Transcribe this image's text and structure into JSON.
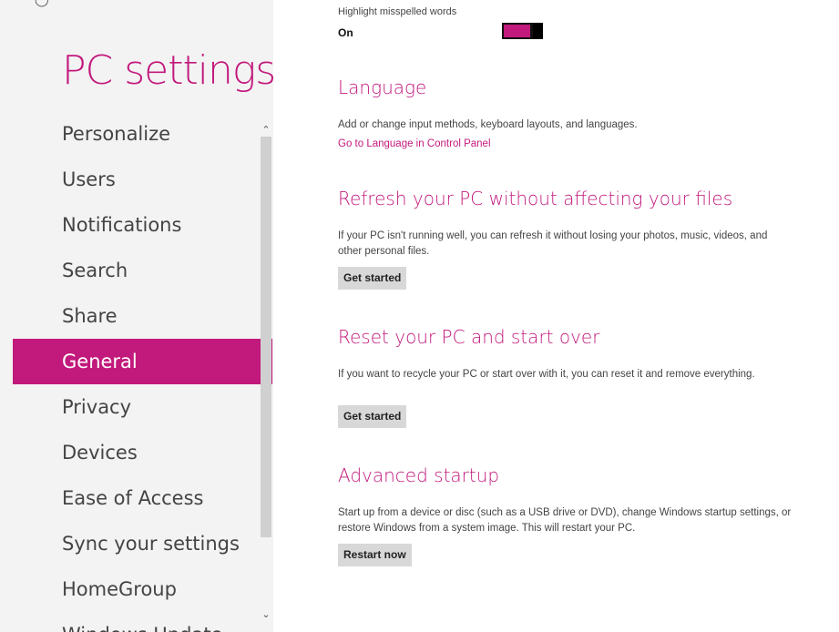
{
  "left": {
    "title": "PC settings",
    "nav": [
      {
        "label": "Personalize"
      },
      {
        "label": "Users"
      },
      {
        "label": "Notifications"
      },
      {
        "label": "Search"
      },
      {
        "label": "Share"
      },
      {
        "label": "General",
        "selected": true
      },
      {
        "label": "Privacy"
      },
      {
        "label": "Devices"
      },
      {
        "label": "Ease of Access"
      },
      {
        "label": "Sync your settings"
      },
      {
        "label": "HomeGroup"
      },
      {
        "label": "Windows Update"
      }
    ]
  },
  "main": {
    "spelling": {
      "label": "Highlight misspelled words",
      "state": "On"
    },
    "language": {
      "heading": "Language",
      "description": "Add or change input methods, keyboard layouts, and languages.",
      "link": "Go to Language in Control Panel"
    },
    "refresh": {
      "heading": "Refresh your PC without affecting your files",
      "description": "If your PC isn't running well, you can refresh it without losing your photos, music, videos, and other personal files.",
      "button": "Get started"
    },
    "reset": {
      "heading": "Reset your PC and start over",
      "description": "If you want to recycle your PC or start over with it, you can reset it and remove everything.",
      "button": "Get started"
    },
    "advanced": {
      "heading": "Advanced startup",
      "description": "Start up from a device or disc (such as a USB drive or DVD), change Windows startup settings, or restore Windows from a system image. This will restart your PC.",
      "button": "Restart now"
    }
  },
  "colors": {
    "accent": "#c2197c",
    "pane": "#f3f3f3"
  },
  "icons": {
    "back": "back-arrow-icon",
    "scroll_up": "chevron-up-icon",
    "scroll_down": "chevron-down-icon"
  }
}
